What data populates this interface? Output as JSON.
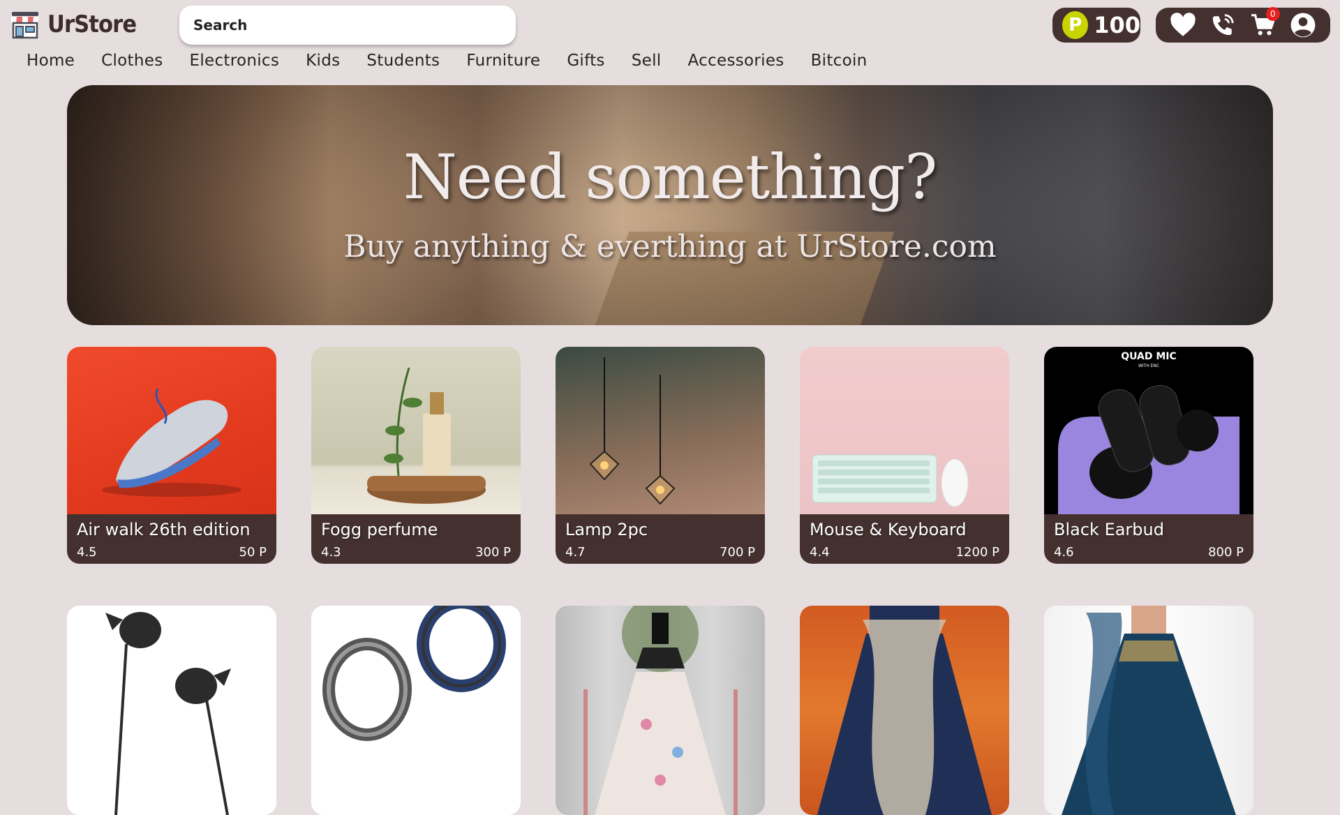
{
  "brand": {
    "name": "UrStore"
  },
  "search": {
    "placeholder": "Search"
  },
  "points": {
    "badge": "P",
    "value": "100"
  },
  "cart": {
    "count": "0"
  },
  "nav": [
    "Home",
    "Clothes",
    "Electronics",
    "Kids",
    "Students",
    "Furniture",
    "Gifts",
    "Sell",
    "Accessories",
    "Bitcoin"
  ],
  "hero": {
    "title": "Need something?",
    "subtitle": "Buy anything & everthing at UrStore.com"
  },
  "products": [
    {
      "name": "Air walk 26th edition",
      "rating": "4.5",
      "price": "50 P"
    },
    {
      "name": "Fogg perfume",
      "rating": "4.3",
      "price": "300 P"
    },
    {
      "name": "Lamp 2pc",
      "rating": "4.7",
      "price": "700 P"
    },
    {
      "name": "Mouse & Keyboard",
      "rating": "4.4",
      "price": "1200 P"
    },
    {
      "name": "Black Earbud",
      "rating": "4.6",
      "price": "800 P"
    }
  ],
  "product_image_text": {
    "earbud_caption": "QUAD MIC",
    "earbud_caption_sub": "WITH ENC"
  },
  "colors": {
    "header_pill": "#43302f",
    "page_bg": "#e6dede",
    "points_badge": "#c9d400",
    "cart_badge": "#e52020"
  }
}
